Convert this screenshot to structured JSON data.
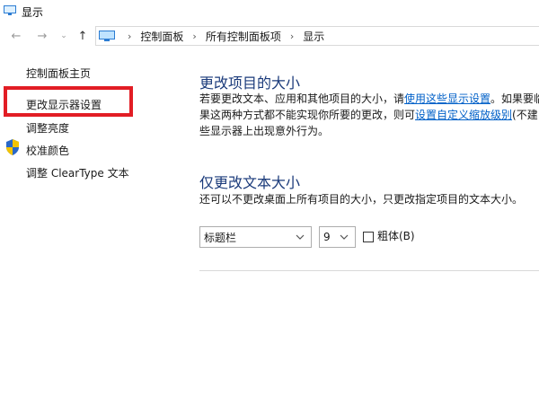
{
  "window": {
    "title": "显示"
  },
  "nav": {
    "breadcrumbs": [
      "控制面板",
      "所有控制面板项",
      "显示"
    ]
  },
  "sidebar": {
    "items": [
      {
        "label": "控制面板主页"
      },
      {
        "label": "更改显示器设置"
      },
      {
        "label": "调整亮度"
      },
      {
        "label": "校准颜色"
      },
      {
        "label": "调整 ClearType 文本"
      }
    ]
  },
  "main": {
    "section1": {
      "title": "更改项目的大小",
      "line1_prefix": "若要更改文本、应用和其他项目的大小，请",
      "line1_link": "使用这些显示设置",
      "line1_suffix": "。如果要临",
      "line2_prefix": "果这两种方式都不能实现你所要的更改，则可",
      "line2_link": "设置自定义缩放级别",
      "line2_suffix": "(不建",
      "line3": "些显示器上出现意外行为。"
    },
    "section2": {
      "title": "仅更改文本大小",
      "desc": "还可以不更改桌面上所有项目的大小，只更改指定项目的文本大小。",
      "item_select": "标题栏",
      "size_select": "9",
      "bold_label": "粗体(B)"
    }
  },
  "colors": {
    "highlight": "#e21d24",
    "link": "#0060c8",
    "heading": "#1a3a7a"
  }
}
